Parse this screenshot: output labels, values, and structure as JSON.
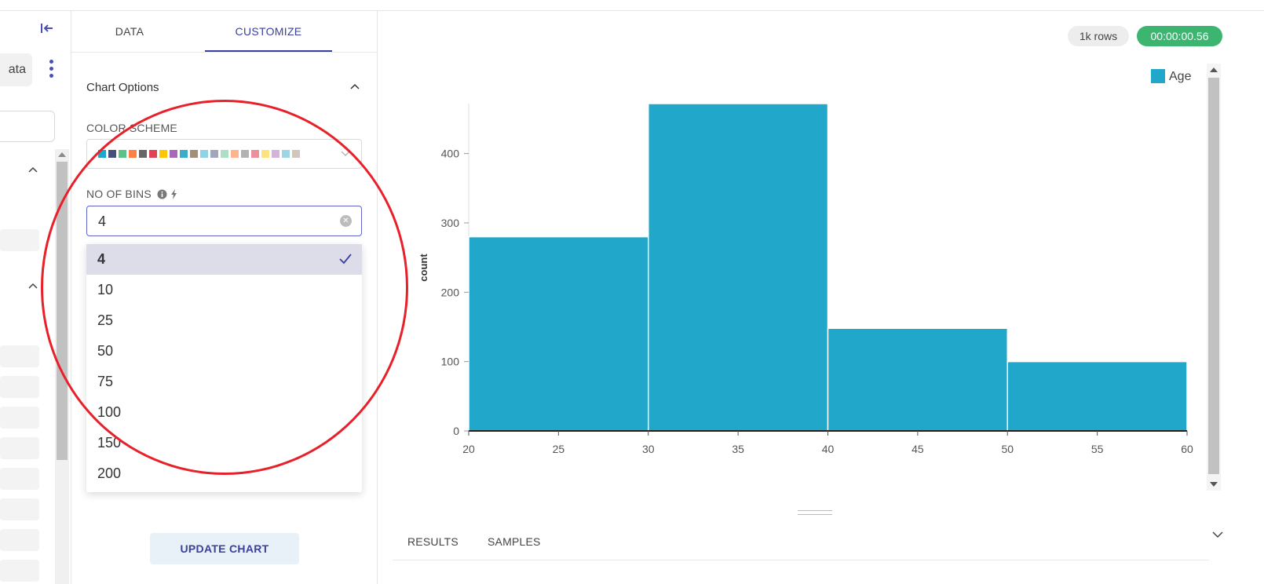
{
  "left_panel": {
    "dataset_button_label": "ata"
  },
  "tabs": [
    {
      "label": "DATA",
      "active": false
    },
    {
      "label": "CUSTOMIZE",
      "active": true
    }
  ],
  "chart_options": {
    "title": "Chart Options",
    "color_scheme_label": "COLOR SCHEME",
    "swatch_colors": [
      "#1fa7c9",
      "#454e7c",
      "#5ac189",
      "#ff7f44",
      "#666666",
      "#e04355",
      "#fcc700",
      "#a868b7",
      "#3caccb",
      "#a38f79",
      "#8fd3e4",
      "#a1a6bd",
      "#acdfc5",
      "#feb48f",
      "#b2b2b2",
      "#ea919d",
      "#fde380",
      "#d4b3da",
      "#9dd5e5",
      "#d1c6bc"
    ],
    "bins_label": "NO OF BINS",
    "bins_value": "4",
    "bins_options": [
      "4",
      "10",
      "25",
      "50",
      "75",
      "100",
      "150",
      "200"
    ],
    "bins_selected": "4",
    "update_button_label": "UPDATE CHART"
  },
  "header_badges": {
    "rows": "1k rows",
    "time": "00:00:00.56"
  },
  "bottom_tabs": [
    "RESULTS",
    "SAMPLES"
  ],
  "colors": {
    "accent": "#3b3f9e",
    "bar": "#20a7c9",
    "success": "#3bb56f",
    "annotation": "#e8202a"
  },
  "chart_data": {
    "type": "bar",
    "histogram": true,
    "bins": [
      {
        "x0": 20,
        "x1": 30,
        "count": 280
      },
      {
        "x0": 30,
        "x1": 40,
        "count": 472
      },
      {
        "x0": 40,
        "x1": 50,
        "count": 148
      },
      {
        "x0": 50,
        "x1": 60,
        "count": 100
      }
    ],
    "series": [
      {
        "name": "Age"
      }
    ],
    "xlabel": "",
    "ylabel": "count",
    "x_ticks": [
      "20",
      "25",
      "30",
      "35",
      "40",
      "45",
      "50",
      "55",
      "60"
    ],
    "y_ticks": [
      "0",
      "100",
      "200",
      "300",
      "400"
    ],
    "xlim": [
      20,
      60
    ],
    "ylim": [
      0,
      472
    ],
    "grid": false,
    "legend_position": "top-right"
  }
}
